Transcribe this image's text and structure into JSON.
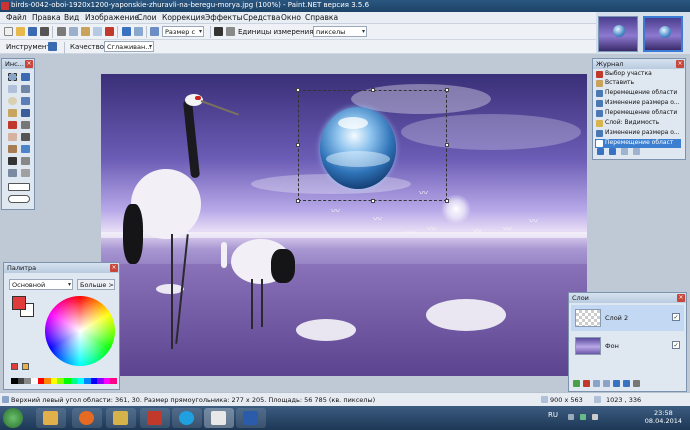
{
  "window": {
    "title": "birds-0042-oboi-1920x1200-yaponskie-zhuravli-na-beregu-morya.jpg (100%) - Paint.NET версия 3.5.6"
  },
  "menu": {
    "items": [
      "Файл",
      "Правка",
      "Вид",
      "Изображение",
      "Слои",
      "Коррекция",
      "Эффекты",
      "Средства",
      "Окно",
      "Справка"
    ]
  },
  "toolbar": {
    "zoom_label": "Размер с",
    "units_label": "Единицы измерения:",
    "units_value": "пикселы"
  },
  "toolbar2": {
    "tool_label": "Инструмент:",
    "quality_label": "Качество:",
    "quality_value": "Сглаживан..."
  },
  "tools_panel": {
    "title": "Инс..."
  },
  "history_panel": {
    "title": "Журнал",
    "items": [
      {
        "label": "Выбор участка",
        "icon": "selection-icon"
      },
      {
        "label": "Вставить",
        "icon": "paste-icon"
      },
      {
        "label": "Перемещение области",
        "icon": "move-icon"
      },
      {
        "label": "Изменение размера о...",
        "icon": "resize-icon"
      },
      {
        "label": "Перемещение области",
        "icon": "move-icon"
      },
      {
        "label": "Слой: Видимость",
        "icon": "layer-visibility-icon"
      },
      {
        "label": "Изменение размера о...",
        "icon": "resize-icon"
      },
      {
        "label": "Перемещение област",
        "icon": "move-icon",
        "selected": true
      }
    ]
  },
  "palette_panel": {
    "title": "Палитра",
    "mode_value": "Основной",
    "more_button": "Больше >>",
    "primary_color": "#e23b3b",
    "secondary_color": "#ffffff"
  },
  "layers_panel": {
    "title": "Слои",
    "layers": [
      {
        "name": "Слой 2",
        "checked": true,
        "active": true
      },
      {
        "name": "Фон",
        "checked": true,
        "active": false
      }
    ]
  },
  "statusbar": {
    "info": "Верхний левый угол области: 361, 30. Размер прямоугольника: 277 x 205. Площадь: 56 785 (кв. пикселы)",
    "image_size": "900 x 563",
    "cursor_pos": "1023 , 336"
  },
  "taskbar": {
    "lang": "RU",
    "time": "23:58",
    "date": "08.04.2014"
  }
}
